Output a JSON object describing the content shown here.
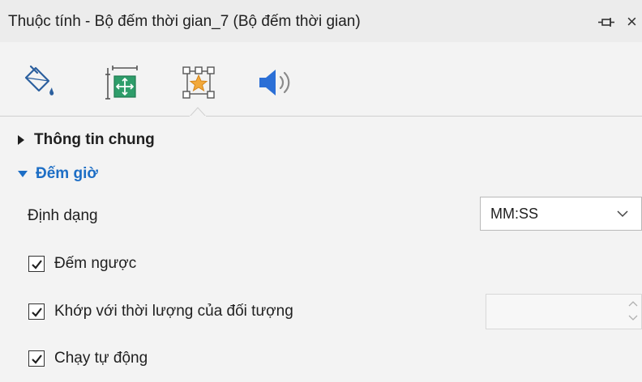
{
  "window": {
    "title": "Thuộc tính - Bộ đếm thời gian_7 (Bộ đếm thời gian)",
    "pin_icon": "pin-icon",
    "close_label": "×"
  },
  "tabs": [
    {
      "icon": "paint-bucket-icon",
      "active": false
    },
    {
      "icon": "size-position-icon",
      "active": false
    },
    {
      "icon": "star-effects-icon",
      "active": true
    },
    {
      "icon": "speaker-sound-icon",
      "active": false
    }
  ],
  "sections": {
    "general": {
      "label": "Thông tin chung",
      "expanded": false
    },
    "counter": {
      "label": "Đếm giờ",
      "expanded": true,
      "format": {
        "label": "Định dạng",
        "value": "MM:SS"
      },
      "countdown": {
        "label": "Đếm ngược",
        "checked": true
      },
      "fit_duration": {
        "label": "Khớp với thời lượng của đối tượng",
        "checked": true,
        "value": ""
      },
      "autorun": {
        "label": "Chạy tự động",
        "checked": true
      }
    }
  },
  "colors": {
    "accent": "#1d6ec5",
    "background": "#f3f3f3",
    "titlebar": "#ececec"
  }
}
